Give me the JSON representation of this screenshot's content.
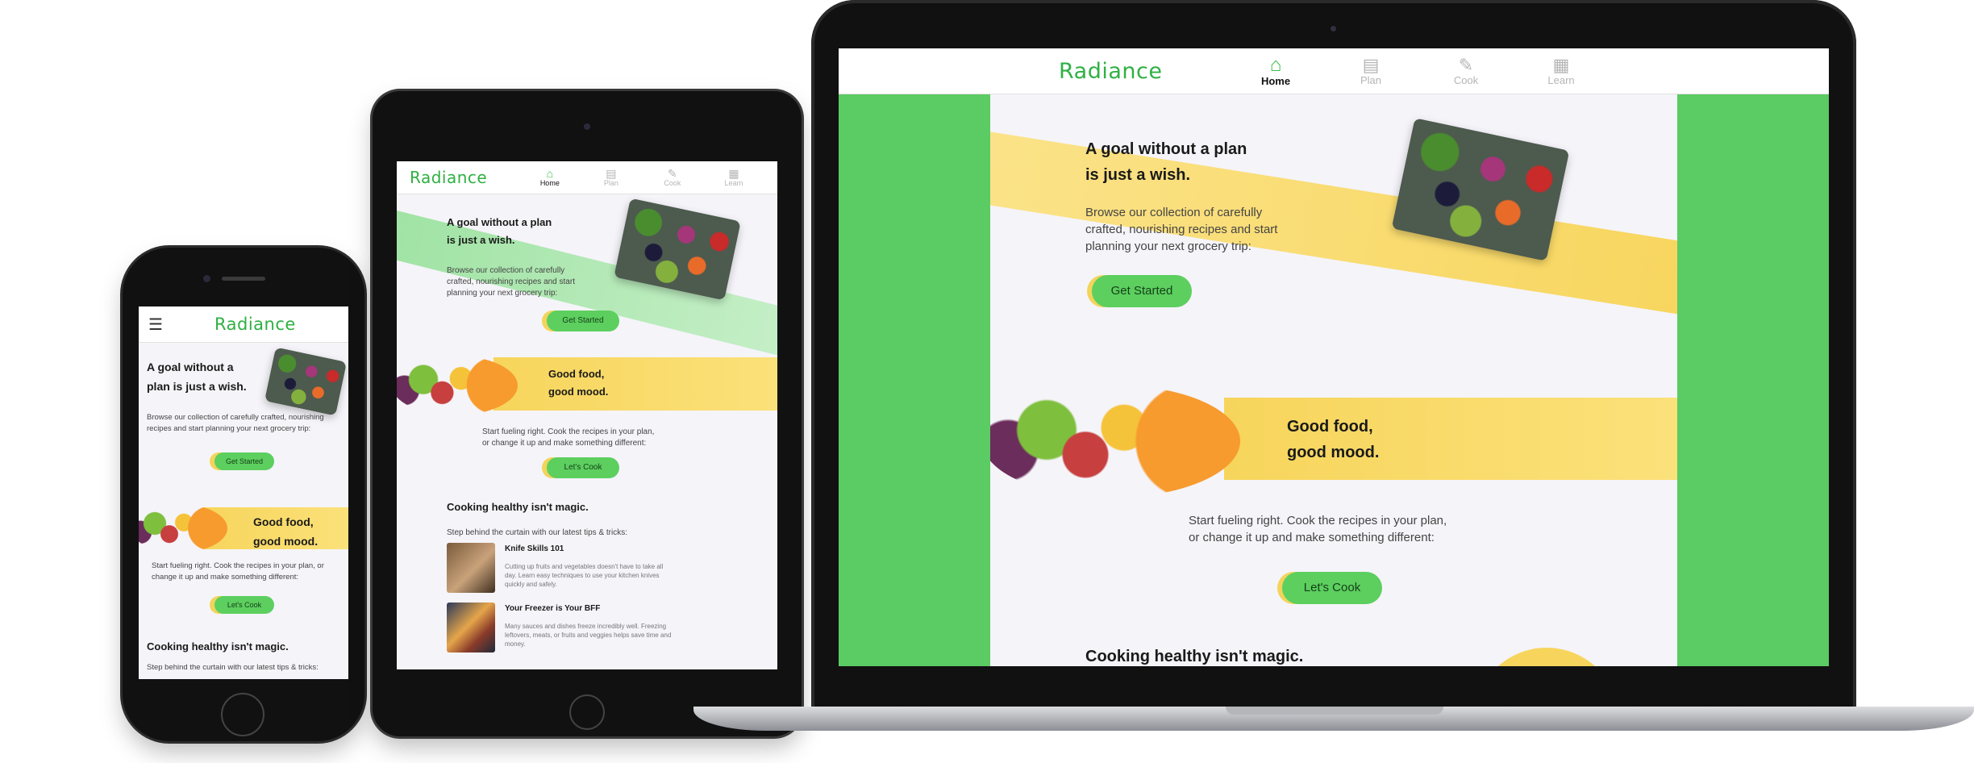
{
  "brand": {
    "logo": "Radiance",
    "green": "#3dbd4f",
    "yellow": "#f7d55c",
    "bg": "#f5f4f9"
  },
  "nav": {
    "items": [
      {
        "label": "Home",
        "icon": "home-icon",
        "active": true
      },
      {
        "label": "Plan",
        "icon": "clipboard-icon",
        "active": false
      },
      {
        "label": "Cook",
        "icon": "carrot-icon",
        "active": false
      },
      {
        "label": "Learn",
        "icon": "book-icon",
        "active": false
      }
    ]
  },
  "hero": {
    "title_line1": "A goal without a plan",
    "title_line2": "is just a wish.",
    "phone_title_line1": "A goal without a",
    "phone_title_line2": "plan is just a wish.",
    "text_line1": "Browse our collection of carefully",
    "text_line2": "crafted, nourishing recipes and start",
    "text_line3": "planning your next grocery trip:",
    "phone_text": "Browse our collection of carefully crafted, nourishing recipes and start planning your next grocery trip:",
    "button": "Get Started"
  },
  "mood": {
    "title_line1": "Good food,",
    "title_line2": "good mood.",
    "text_line1": "Start fueling right.  Cook the recipes in your plan,",
    "text_line2": "or change it up and make something different:",
    "phone_text": "Start fueling right.  Cook the recipes in your plan, or change it up and make something different:",
    "button": "Let's Cook"
  },
  "magic": {
    "title": "Cooking healthy isn't magic.",
    "intro": "Step behind the curtain with our latest tips & tricks:",
    "articles": [
      {
        "title": "Knife Skills 101",
        "text": "Cutting up fruits and vegetables doesn't have to take all day.  Learn easy techniques to use your kitchen knives quickly and safely."
      },
      {
        "title": "Your Freezer is Your BFF",
        "text": "Many sauces and dishes freeze incredibly well. Freezing leftovers, meats, or fruits and veggies helps save time and money."
      }
    ]
  },
  "icons": {
    "menu": "hamburger-menu-icon"
  }
}
